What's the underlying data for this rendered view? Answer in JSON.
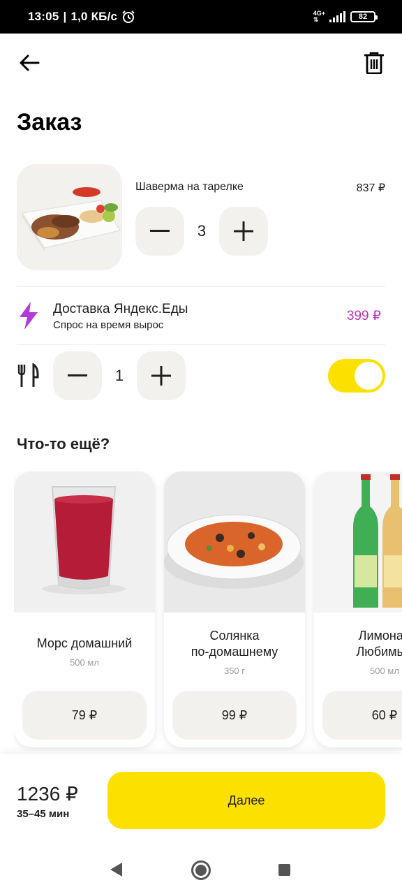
{
  "status_bar": {
    "time": "13:05",
    "net_speed": "1,0 КБ/с",
    "network_type": "4G+",
    "battery": "82"
  },
  "header": {
    "title": "Заказ"
  },
  "order_item": {
    "name": "Шаверма на тарелке",
    "price": "837 ₽",
    "quantity": "3"
  },
  "delivery": {
    "title": "Доставка Яндекс.Еды",
    "subtitle": "Спрос на время вырос",
    "price": "399 ₽"
  },
  "cutlery": {
    "quantity": "1",
    "toggle_on": true
  },
  "upsell": {
    "title": "Что-то ещё?",
    "items": [
      {
        "name": "Морс домашний",
        "size": "500 мл",
        "price": "79 ₽"
      },
      {
        "name_line1": "Солянка",
        "name_line2": "по-домашнему",
        "size": "350 г",
        "price": "99 ₽"
      },
      {
        "name_line1": "Лимонад",
        "name_line2": "Любимый",
        "size": "500 мл",
        "price": "60 ₽"
      }
    ]
  },
  "footer": {
    "total": "1236 ₽",
    "eta": "35–45 мин",
    "next_label": "Далее"
  },
  "colors": {
    "accent_yellow": "#fce000",
    "delivery_purple": "#c030c0",
    "button_gray": "#f2f1ee"
  }
}
